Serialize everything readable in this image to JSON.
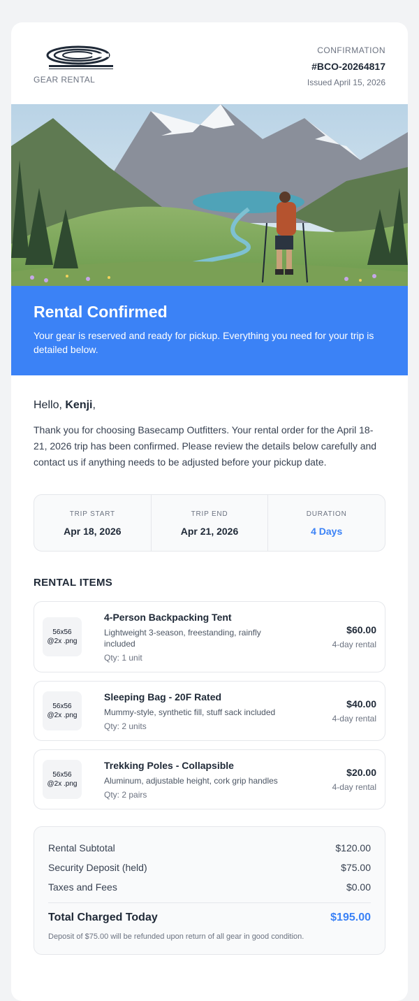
{
  "header": {
    "logo_icon": "company-logo",
    "brand_subtitle": "GEAR RENTAL",
    "confirmation_label": "CONFIRMATION",
    "confirmation_number": "#BCO-20264817",
    "issued": "Issued April 15, 2026"
  },
  "hero": {
    "icon": "mountain-lake-hiker-illustration"
  },
  "banner": {
    "title": "Rental Confirmed",
    "subtitle": "Your gear is reserved and ready for pickup. Everything you need for your trip is detailed below.",
    "background": "#3b82f6"
  },
  "greeting": {
    "prefix": "Hello, ",
    "name": "Kenji",
    "suffix": ","
  },
  "intro": "Thank you for choosing Basecamp Outfitters. Your rental order for the April 18-21, 2026 trip has been confirmed. Please review the details below carefully and contact us if anything needs to be adjusted before your pickup date.",
  "trip": [
    {
      "label": "TRIP START",
      "value": "Apr 18, 2026"
    },
    {
      "label": "TRIP END",
      "value": "Apr 21, 2026"
    },
    {
      "label": "DURATION",
      "value": "4 Days"
    }
  ],
  "items_title": "RENTAL ITEMS",
  "items": [
    {
      "thumb": "56x56 @2x .png",
      "name": "4-Person Backpacking Tent",
      "desc": "Lightweight 3-season, freestanding, rainfly included",
      "qty": "Qty: 1 unit",
      "price": "$60.00",
      "term": "4-day rental"
    },
    {
      "thumb": "56x56 @2x .png",
      "name": "Sleeping Bag - 20F Rated",
      "desc": "Mummy-style, synthetic fill, stuff sack included",
      "qty": "Qty: 2 units",
      "price": "$40.00",
      "term": "4-day rental"
    },
    {
      "thumb": "56x56 @2x .png",
      "name": "Trekking Poles - Collapsible",
      "desc": "Aluminum, adjustable height, cork grip handles",
      "qty": "Qty: 2 pairs",
      "price": "$20.00",
      "term": "4-day rental"
    }
  ],
  "summary": {
    "rows": [
      {
        "label": "Rental Subtotal",
        "value": "$120.00"
      },
      {
        "label": "Security Deposit (held)",
        "value": "$75.00"
      },
      {
        "label": "Taxes and Fees",
        "value": "$0.00"
      }
    ],
    "total_label": "Total Charged Today",
    "total_value": "$195.00",
    "note": "Deposit of $75.00 will be refunded upon return of all gear in good condition.",
    "accent": "#3b82f6"
  }
}
